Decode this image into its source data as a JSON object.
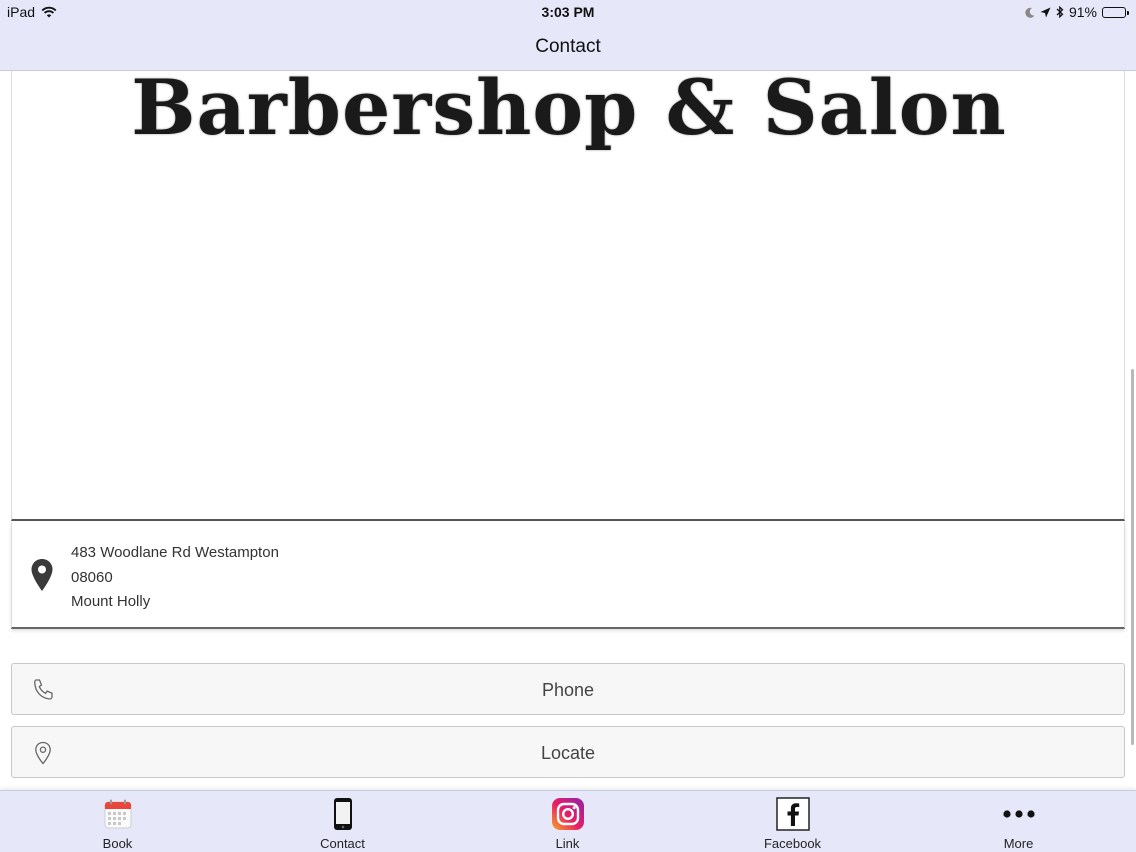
{
  "status_bar": {
    "device": "iPad",
    "time": "3:03 PM",
    "battery_percent": "91%",
    "battery_level": 0.91
  },
  "nav": {
    "title": "Contact"
  },
  "logo": {
    "text": "Barbershop & Salon"
  },
  "address": {
    "line1": "483 Woodlane Rd Westampton",
    "line2": "08060",
    "line3": "Mount Holly"
  },
  "actions": {
    "phone_label": "Phone",
    "locate_label": "Locate"
  },
  "tabs": [
    {
      "label": "Book",
      "icon": "calendar-icon"
    },
    {
      "label": "Contact",
      "icon": "phone-device-icon"
    },
    {
      "label": "Link",
      "icon": "instagram-icon"
    },
    {
      "label": "Facebook",
      "icon": "facebook-icon"
    },
    {
      "label": "More",
      "icon": "more-dots-icon"
    }
  ],
  "colors": {
    "bar_background": "#e6e8fa",
    "calendar_red": "#e8463a",
    "instagram_gradient_start": "#f9a825",
    "instagram_gradient_end": "#8e24aa"
  }
}
